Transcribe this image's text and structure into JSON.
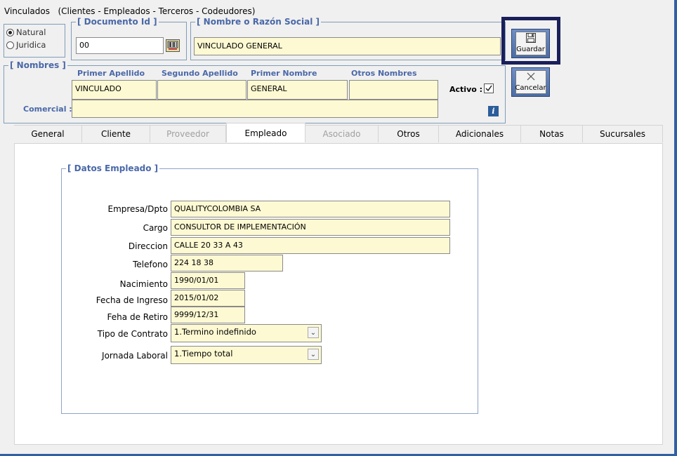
{
  "window": {
    "title": "Vinculados",
    "subtitle": "(Clientes - Empleados - Terceros - Codeudores)"
  },
  "person_type": {
    "options": [
      "Natural",
      "Juridica"
    ],
    "selected": "Natural"
  },
  "documento": {
    "legend": "[ Documento Id ]",
    "value": "00"
  },
  "nombre": {
    "legend": "[ Nombre o Razón Social ]",
    "value": "VINCULADO GENERAL"
  },
  "toolbar": {
    "save_label": "Guardar",
    "cancel_label": "Cancelar"
  },
  "nombres": {
    "legend": "[ Nombres ]",
    "primer_apellido_label": "Primer Apellido",
    "segundo_apellido_label": "Segundo Apellido",
    "primer_nombre_label": "Primer Nombre",
    "otros_nombres_label": "Otros Nombres",
    "primer_apellido": "VINCULADO",
    "segundo_apellido": "",
    "primer_nombre": "GENERAL",
    "otros_nombres": "",
    "activo_label": "Activo :",
    "activo_checked": true,
    "comercial_label": "Comercial :",
    "comercial": "",
    "info_icon": "i"
  },
  "tabs": [
    {
      "label": "General",
      "state": "normal"
    },
    {
      "label": "Cliente",
      "state": "normal"
    },
    {
      "label": "Proveedor",
      "state": "disabled"
    },
    {
      "label": "Empleado",
      "state": "active"
    },
    {
      "label": "Asociado",
      "state": "disabled"
    },
    {
      "label": "Otros",
      "state": "normal"
    },
    {
      "label": "Adicionales",
      "state": "normal"
    },
    {
      "label": "Notas",
      "state": "normal"
    },
    {
      "label": "Sucursales",
      "state": "normal"
    }
  ],
  "empleado": {
    "legend": "[ Datos Empleado ]",
    "empresa_label": "Empresa/Dpto",
    "empresa": "QUALITYCOLOMBIA SA",
    "cargo_label": "Cargo",
    "cargo": "CONSULTOR DE IMPLEMENTACIÓN",
    "direccion_label": "Direccion",
    "direccion": "CALLE 20 33 A 43",
    "telefono_label": "Telefono",
    "telefono": "224 18 38",
    "nacimiento_label": "Nacimiento",
    "nacimiento": "1990/01/01",
    "ingreso_label": "Fecha de Ingreso",
    "ingreso": "2015/01/02",
    "retiro_label": "Feha de Retiro",
    "retiro": "9999/12/31",
    "contrato_label": "Tipo de Contrato",
    "contrato": "1.Termino indefinido",
    "jornada_label": "Jornada Laboral",
    "jornada": "1.Tiempo total"
  },
  "colors": {
    "accent": "#4a68a8",
    "field_bg": "#fdf9d2",
    "highlight_border": "#1a1f5a"
  }
}
